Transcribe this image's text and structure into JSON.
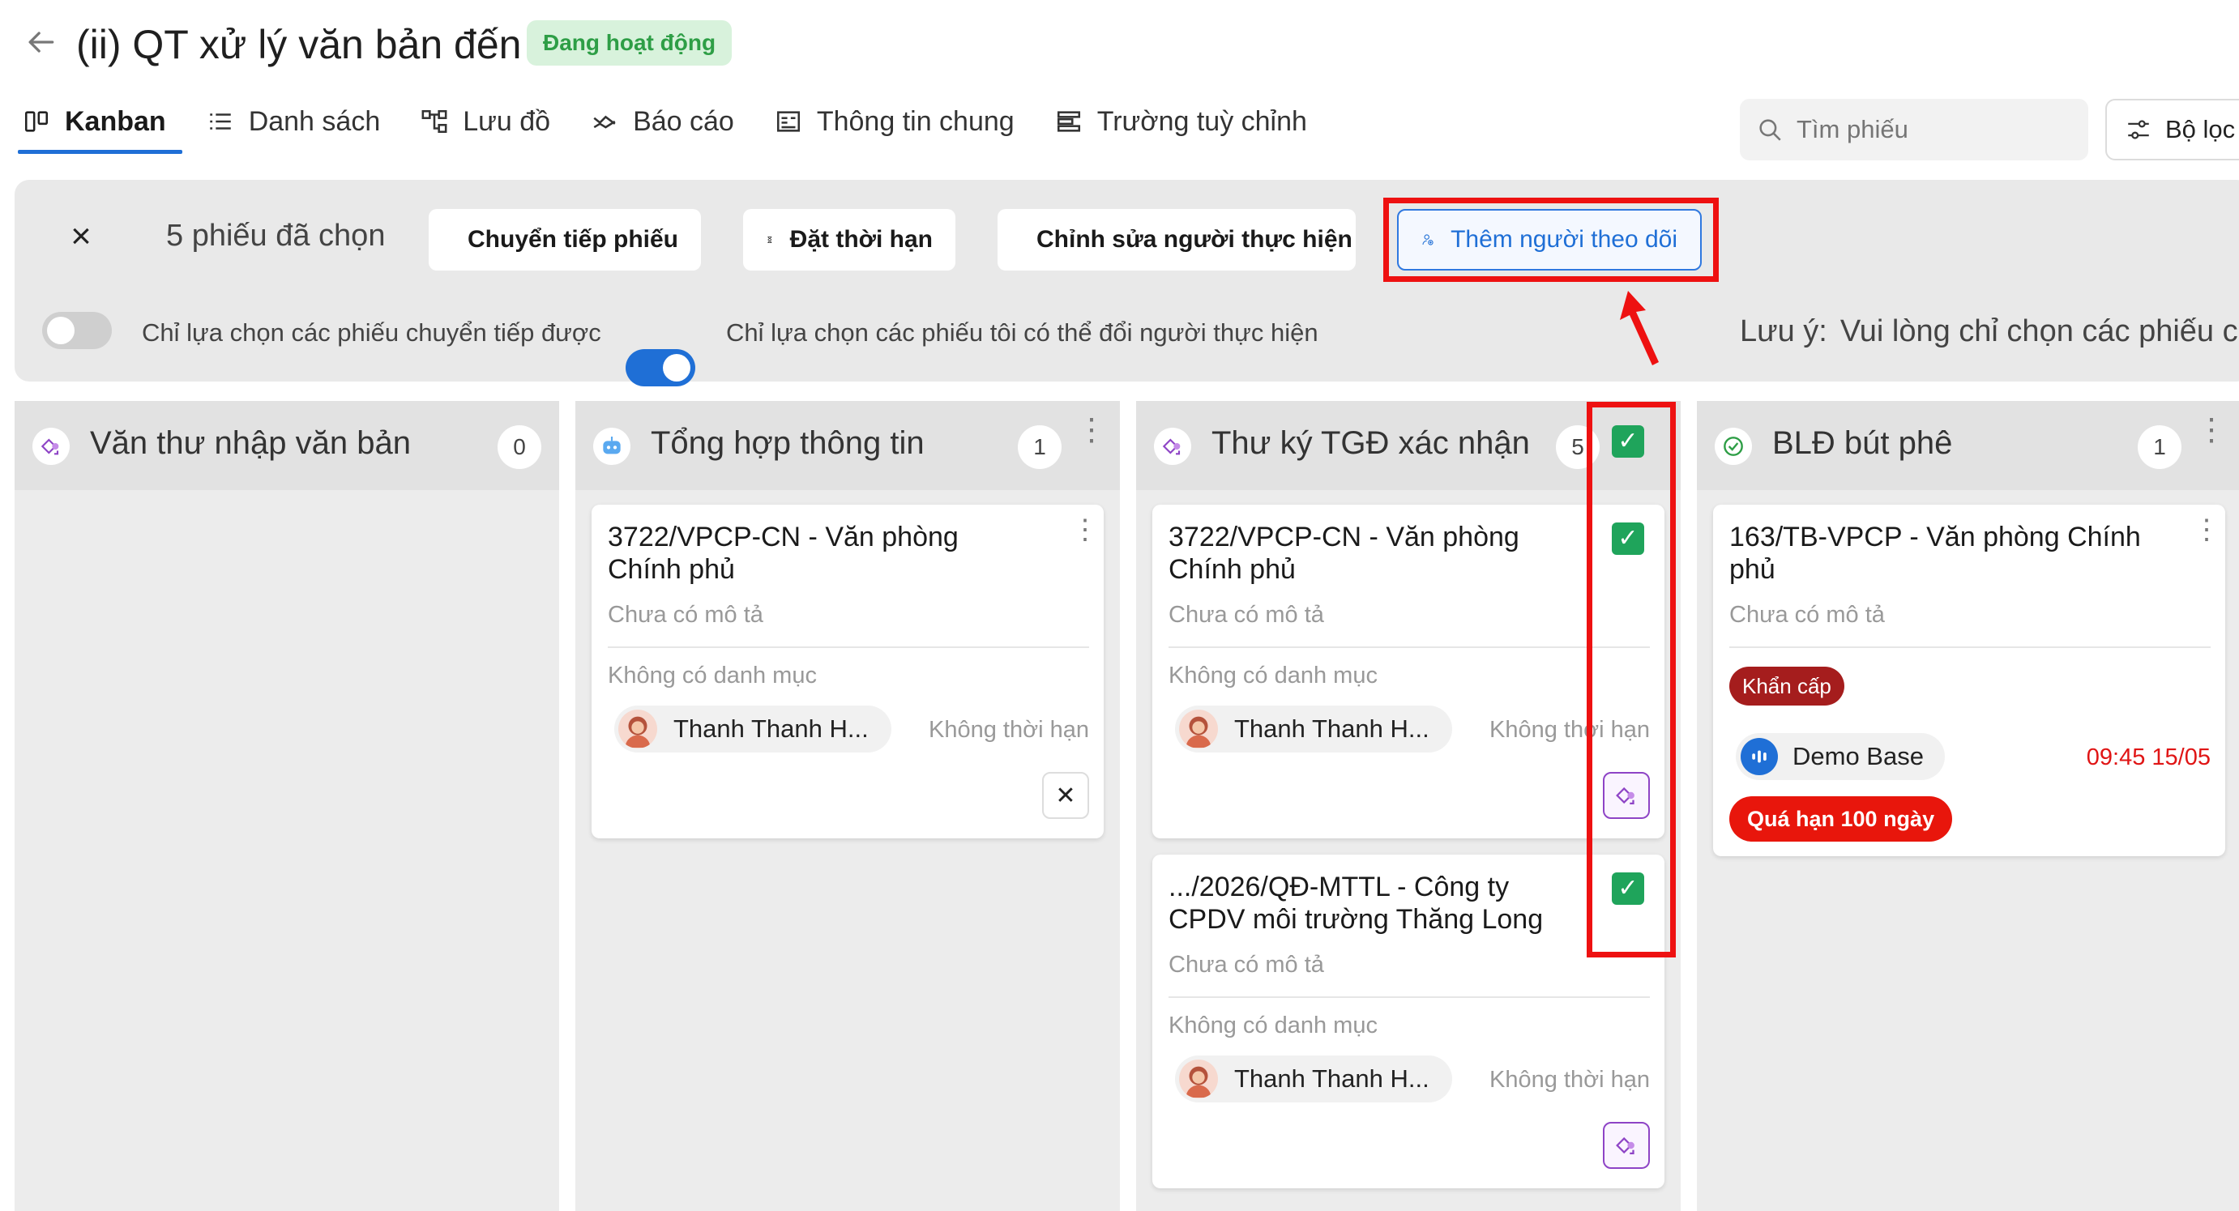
{
  "header": {
    "title": "(ii) QT xử lý văn bản đến",
    "status": "Đang hoạt động",
    "back_icon": "back-arrow-icon"
  },
  "tabs": [
    {
      "label": "Kanban",
      "icon": "kanban-icon",
      "active": true
    },
    {
      "label": "Danh sách",
      "icon": "list-icon"
    },
    {
      "label": "Lưu đồ",
      "icon": "flowchart-icon"
    },
    {
      "label": "Báo cáo",
      "icon": "report-icon"
    },
    {
      "label": "Thông tin chung",
      "icon": "info-icon"
    },
    {
      "label": "Trường tuỳ chỉnh",
      "icon": "custom-fields-icon"
    }
  ],
  "search": {
    "placeholder": "Tìm phiếu"
  },
  "filter": {
    "label": "Bộ lọc"
  },
  "selection": {
    "close": "×",
    "count_label": "5 phiếu đã chọn",
    "actions": {
      "forward": "Chuyển tiếp phiếu",
      "deadline": "Đặt thời hạn",
      "assignee": "Chỉnh sửa người thực hiện",
      "follower": "Thêm người theo dõi"
    },
    "toggle_forward": {
      "label": "Chỉ lựa chọn các phiếu chuyển tiếp được",
      "on": false
    },
    "toggle_assignee": {
      "label": "Chỉ lựa chọn các phiếu tôi có thể đổi người thực hiện",
      "on": true
    },
    "note_prefix": "Lưu ý:",
    "note_text": "Vui lòng chỉ chọn các phiếu c"
  },
  "columns": [
    {
      "title": "Văn thư nhập văn bản",
      "count": "0"
    },
    {
      "title": "Tổng hợp thông tin",
      "count": "1",
      "cards": [
        {
          "title": "3722/VPCP-CN - Văn phòng Chính phủ",
          "description": "Chưa có mô tả",
          "category": "Không có danh mục",
          "assignee": "Thanh Thanh H...",
          "deadline": "Không thời hạn",
          "x_label": "✕"
        }
      ]
    },
    {
      "title": "Thư ký TGĐ xác nhận",
      "count": "5",
      "cards": [
        {
          "title": "3722/VPCP-CN - Văn phòng Chính phủ",
          "description": "Chưa có mô tả",
          "category": "Không có danh mục",
          "assignee": "Thanh Thanh H...",
          "deadline": "Không thời hạn"
        },
        {
          "title": ".../2026/QĐ-MTTL - Công ty CPDV môi trường Thăng Long",
          "description": "Chưa có mô tả",
          "category": "Không có danh mục",
          "assignee": "Thanh Thanh H...",
          "deadline": "Không thời hạn"
        }
      ]
    },
    {
      "title": "BLĐ bút phê",
      "count": "1",
      "cards": [
        {
          "title": "163/TB-VPCP - Văn phòng Chính phủ",
          "description": "Chưa có mô tả",
          "tag": "Khẩn cấp",
          "base": "Demo Base",
          "due": "09:45 15/05",
          "overdue": "Quá hạn 100 ngày"
        }
      ]
    }
  ],
  "check_mark": "✓",
  "colors": {
    "accent": "#1f6fd6",
    "success": "#1fa45b",
    "danger": "#e8160c",
    "urgent": "#a51d1d",
    "highlight": "#ee1111"
  }
}
